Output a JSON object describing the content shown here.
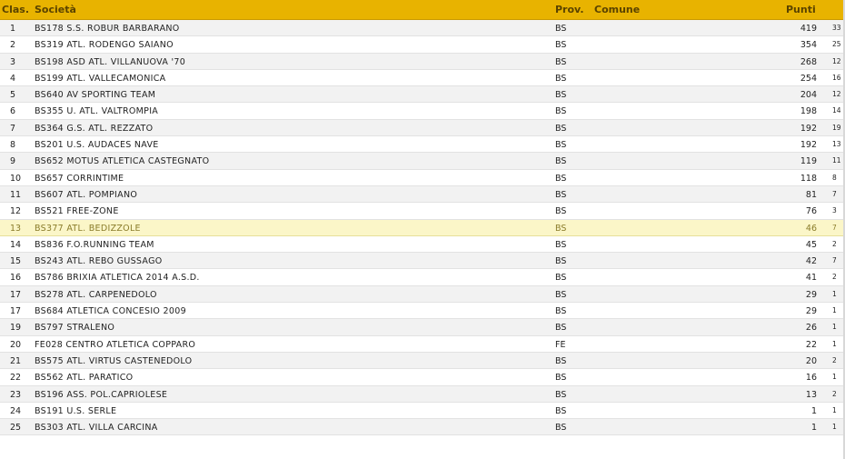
{
  "header": {
    "clas": "Clas.",
    "societa": "Società",
    "prov": "Prov.",
    "comune": "Comune",
    "punti": "Punti"
  },
  "rows": [
    {
      "rank": "1",
      "club": "BS178 S.S. ROBUR BARBARANO",
      "prov": "BS",
      "punti": "419",
      "extra": "33"
    },
    {
      "rank": "2",
      "club": "BS319 ATL. RODENGO SAIANO",
      "prov": "BS",
      "punti": "354",
      "extra": "25"
    },
    {
      "rank": "3",
      "club": "BS198 ASD ATL. VILLANUOVA '70",
      "prov": "BS",
      "punti": "268",
      "extra": "12"
    },
    {
      "rank": "4",
      "club": "BS199 ATL. VALLECAMONICA",
      "prov": "BS",
      "punti": "254",
      "extra": "16"
    },
    {
      "rank": "5",
      "club": "BS640 AV SPORTING TEAM",
      "prov": "BS",
      "punti": "204",
      "extra": "12"
    },
    {
      "rank": "6",
      "club": "BS355 U. ATL. VALTROMPIA",
      "prov": "BS",
      "punti": "198",
      "extra": "14"
    },
    {
      "rank": "7",
      "club": "BS364 G.S. ATL. REZZATO",
      "prov": "BS",
      "punti": "192",
      "extra": "19"
    },
    {
      "rank": "8",
      "club": "BS201 U.S. AUDACES NAVE",
      "prov": "BS",
      "punti": "192",
      "extra": "13"
    },
    {
      "rank": "9",
      "club": "BS652 MOTUS ATLETICA CASTEGNATO",
      "prov": "BS",
      "punti": "119",
      "extra": "11"
    },
    {
      "rank": "10",
      "club": "BS657 CORRINTIME",
      "prov": "BS",
      "punti": "118",
      "extra": "8"
    },
    {
      "rank": "11",
      "club": "BS607 ATL. POMPIANO",
      "prov": "BS",
      "punti": "81",
      "extra": "7"
    },
    {
      "rank": "12",
      "club": "BS521 FREE-ZONE",
      "prov": "BS",
      "punti": "76",
      "extra": "3"
    },
    {
      "rank": "13",
      "club": "BS377 ATL. BEDIZZOLE",
      "prov": "BS",
      "punti": "46",
      "extra": "7",
      "highlight": true
    },
    {
      "rank": "14",
      "club": "BS836 F.O.RUNNING TEAM",
      "prov": "BS",
      "punti": "45",
      "extra": "2"
    },
    {
      "rank": "15",
      "club": "BS243 ATL. REBO GUSSAGO",
      "prov": "BS",
      "punti": "42",
      "extra": "7"
    },
    {
      "rank": "16",
      "club": "BS786 BRIXIA ATLETICA 2014 A.S.D.",
      "prov": "BS",
      "punti": "41",
      "extra": "2"
    },
    {
      "rank": "17",
      "club": "BS278 ATL. CARPENEDOLO",
      "prov": "BS",
      "punti": "29",
      "extra": "1"
    },
    {
      "rank": "17",
      "club": "BS684 ATLETICA CONCESIO 2009",
      "prov": "BS",
      "punti": "29",
      "extra": "1"
    },
    {
      "rank": "19",
      "club": "BS797 STRALENO",
      "prov": "BS",
      "punti": "26",
      "extra": "1"
    },
    {
      "rank": "20",
      "club": "FE028 CENTRO ATLETICA COPPARO",
      "prov": "FE",
      "punti": "22",
      "extra": "1"
    },
    {
      "rank": "21",
      "club": "BS575 ATL. VIRTUS CASTENEDOLO",
      "prov": "BS",
      "punti": "20",
      "extra": "2"
    },
    {
      "rank": "22",
      "club": "BS562 ATL. PARATICO",
      "prov": "BS",
      "punti": "16",
      "extra": "1"
    },
    {
      "rank": "23",
      "club": "BS196 ASS. POL.CAPRIOLESE",
      "prov": "BS",
      "punti": "13",
      "extra": "2"
    },
    {
      "rank": "24",
      "club": "BS191 U.S. SERLE",
      "prov": "BS",
      "punti": "1",
      "extra": "1"
    },
    {
      "rank": "25",
      "club": "BS303 ATL. VILLA CARCINA",
      "prov": "BS",
      "punti": "1",
      "extra": "1"
    }
  ]
}
